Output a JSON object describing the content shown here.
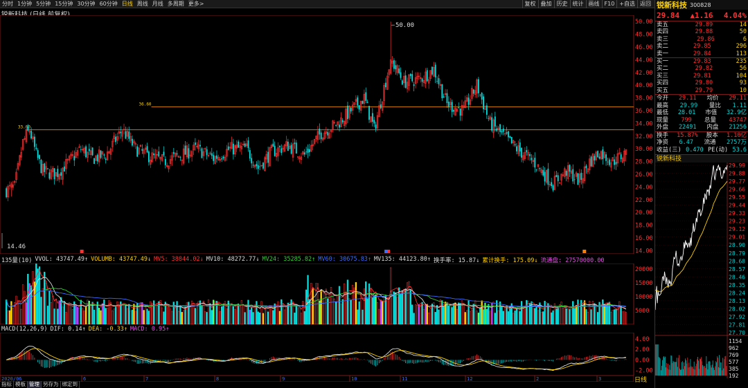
{
  "toolbar": {
    "timeframes": [
      "分时",
      "1分钟",
      "5分钟",
      "15分钟",
      "30分钟",
      "60分钟",
      "日线",
      "周线",
      "月线",
      "多周期",
      "更多>"
    ],
    "active_timeframe": "日线",
    "buttons": [
      "复权",
      "叠加",
      "历史",
      "统计",
      "画线",
      "F10",
      "+自选",
      "返回"
    ]
  },
  "chart": {
    "title": "锐新科技 (日线,前复权)",
    "high_label": "50.00",
    "low_label": "14.46",
    "mark_3660": "36.60",
    "mark_3300": "33.00",
    "price_axis": [
      "50.00",
      "48.00",
      "46.00",
      "44.00",
      "42.00",
      "40.00",
      "38.00",
      "36.00",
      "34.00",
      "32.00",
      "30.00",
      "28.00",
      "26.00",
      "24.00",
      "22.00",
      "20.00",
      "18.00",
      "16.00",
      "14.00"
    ],
    "month_labels": [
      "6",
      "7",
      "8",
      "9",
      "10",
      "11",
      "12",
      "2",
      "3"
    ],
    "start_label": "2020/06"
  },
  "volume": {
    "legend": [
      {
        "text": "135量(10)",
        "color": "#ddd"
      },
      {
        "text": "VVOL: 43747.49↑",
        "color": "#ddd"
      },
      {
        "text": "VOLUMB: 43747.49↓",
        "color": "#ffd200"
      },
      {
        "text": "MV5: 38844.02↓",
        "color": "#ff3030"
      },
      {
        "text": "MV10: 48272.77↓",
        "color": "#ddd"
      },
      {
        "text": "MV24: 35285.82↑",
        "color": "#30d030"
      },
      {
        "text": "MV60: 30675.83↑",
        "color": "#3a6cff"
      },
      {
        "text": "MV135: 44123.80↑",
        "color": "#ddd"
      },
      {
        "text": "换手率: 15.87↓",
        "color": "#ddd"
      },
      {
        "text": "累计换手: 175.09↓",
        "color": "#ffd200"
      },
      {
        "text": "流通盘: 27570000.00",
        "color": "#e050e0"
      }
    ],
    "axis": [
      "20000",
      "15000",
      "10000",
      "5000"
    ]
  },
  "macd": {
    "legend": [
      {
        "text": "MACD(12,26,9)",
        "color": "#ddd"
      },
      {
        "text": "DIF: 0.14↑",
        "color": "#ddd"
      },
      {
        "text": "DEA: -0.33↑",
        "color": "#ffd200"
      },
      {
        "text": "MACD: 0.95↑",
        "color": "#e050e0"
      }
    ],
    "axis": [
      "4.00",
      "2.00",
      "0.00",
      "-2.00"
    ]
  },
  "bottom_tabs": [
    "指标",
    "模板",
    "管理",
    "另存为",
    "绑定到"
  ],
  "bottom_active": "管理",
  "period_label": "日线",
  "quote": {
    "name": "锐新科技",
    "code": "300828",
    "price": "29.84",
    "change": "▲1.16",
    "pct": "4.04%",
    "asks": [
      {
        "label": "卖五",
        "price": "29.89",
        "vol": "14"
      },
      {
        "label": "卖四",
        "price": "29.88",
        "vol": "50"
      },
      {
        "label": "卖三",
        "price": "29.86",
        "vol": "6"
      },
      {
        "label": "卖二",
        "price": "29.85",
        "vol": "296"
      },
      {
        "label": "卖一",
        "price": "29.84",
        "vol": "113"
      }
    ],
    "bids": [
      {
        "label": "买一",
        "price": "29.83",
        "vol": "235"
      },
      {
        "label": "买二",
        "price": "29.82",
        "vol": "56"
      },
      {
        "label": "买三",
        "price": "29.81",
        "vol": "104"
      },
      {
        "label": "买四",
        "price": "29.80",
        "vol": "93"
      },
      {
        "label": "买五",
        "price": "29.79",
        "vol": "10"
      }
    ],
    "stats": [
      {
        "a": "今开",
        "b": "29.11",
        "c": "均价",
        "d": "29.11"
      },
      {
        "a": "最高",
        "b": "29.99",
        "c": "量比",
        "d": "1.11"
      },
      {
        "a": "最低",
        "b": "28.01",
        "c": "市值",
        "d": "32.9亿"
      },
      {
        "a": "现量",
        "b": "799",
        "c": "总量",
        "d": "43747"
      },
      {
        "a": "外盘",
        "b": "22491",
        "c": "内盘",
        "d": "21256"
      }
    ],
    "stats2": [
      {
        "a": "换手",
        "b": "15.87%",
        "c": "股本",
        "d": "1.10亿"
      },
      {
        "a": "净资",
        "b": "6.47",
        "c": "流通",
        "d": "2757万"
      },
      {
        "a": "收益(三)",
        "b": "0.470",
        "c": "PE(动)",
        "d": "53.6"
      }
    ],
    "mini_title": "锐新科技",
    "mini_axis": [
      "29.99",
      "29.88",
      "29.77",
      "29.66",
      "29.55",
      "29.44",
      "29.33",
      "29.23",
      "29.12",
      "29.01",
      "28.90",
      "28.79",
      "28.68",
      "28.57",
      "28.46",
      "28.35",
      "28.24",
      "28.13",
      "28.02",
      "27.92",
      "27.81",
      "27.70"
    ],
    "mini_vol_axis": [
      "1154",
      "962",
      "769",
      "577",
      "385",
      "192"
    ]
  }
}
